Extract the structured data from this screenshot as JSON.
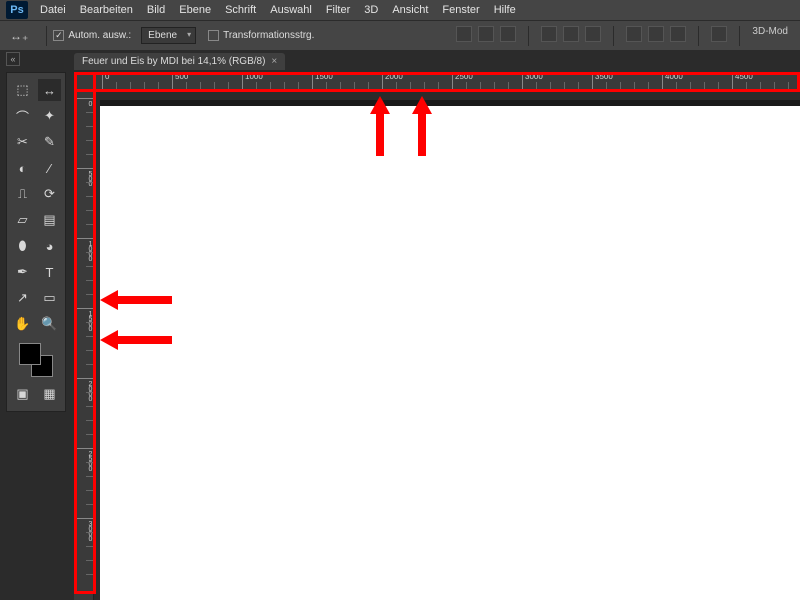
{
  "app_logo": "Ps",
  "menu": [
    "Datei",
    "Bearbeiten",
    "Bild",
    "Ebene",
    "Schrift",
    "Auswahl",
    "Filter",
    "3D",
    "Ansicht",
    "Fenster",
    "Hilfe"
  ],
  "options": {
    "auto_select": "Autom. ausw.:",
    "layer_select": "Ebene",
    "transform": "Transformationsstrg.",
    "right_mode": "3D-Mod"
  },
  "tab": {
    "title": "Feuer und Eis by MDI bei 14,1% (RGB/8)",
    "close": "×"
  },
  "tools": [
    [
      "marquee",
      "⬚",
      "move",
      "↔"
    ],
    [
      "lasso",
      "◯",
      "wand",
      "✦"
    ],
    [
      "crop",
      "⟂",
      "eyedropper",
      "✎"
    ],
    [
      "heal",
      "◐",
      "brush",
      "🖌"
    ],
    [
      "stamp",
      "⎍",
      "history",
      "⟳"
    ],
    [
      "eraser",
      "▭",
      "gradient",
      "▤"
    ],
    [
      "blur",
      "⬮",
      "dodge",
      "◕"
    ],
    [
      "pen",
      "✒",
      "type",
      "T"
    ],
    [
      "path",
      "↗",
      "shape",
      "▭"
    ],
    [
      "hand",
      "✋",
      "zoom",
      "🔍"
    ]
  ],
  "extra_tools": [
    "▭",
    "▦"
  ],
  "ruler_h": [
    0,
    500,
    1000,
    1500,
    2000,
    2500,
    3000,
    3500,
    4000,
    4500
  ],
  "ruler_v": [
    0,
    500,
    1000,
    1500,
    2000,
    2500,
    3000
  ],
  "annotations": {
    "top_arrows": 2,
    "left_arrows": 2
  }
}
